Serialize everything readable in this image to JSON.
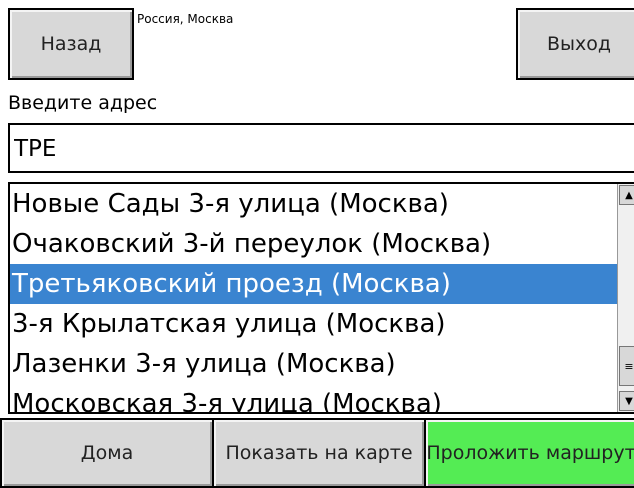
{
  "header": {
    "back_label": "Назад",
    "exit_label": "Выход",
    "region": "Россия, Москва"
  },
  "address": {
    "prompt": "Введите адрес",
    "value": "ТРЕ"
  },
  "results": {
    "items": [
      "Новые Сады 3-я улица (Москва)",
      "Очаковский 3-й переулок (Москва)",
      "Третьяковский проезд (Москва)",
      "3-я Крылатская улица (Москва)",
      "Лазенки 3-я улица (Москва)",
      "Московская 3-я улица (Москва)"
    ],
    "selected_index": 2,
    "scroll": {
      "up_icon": "arrow-up-icon",
      "down_icon": "arrow-down-icon",
      "thumb_icon": "grip-icon"
    }
  },
  "footer": {
    "home_label": "Дома",
    "map_label": "Показать на карте",
    "route_label": "Проложить маршрут",
    "route_color": "#54ec54"
  }
}
